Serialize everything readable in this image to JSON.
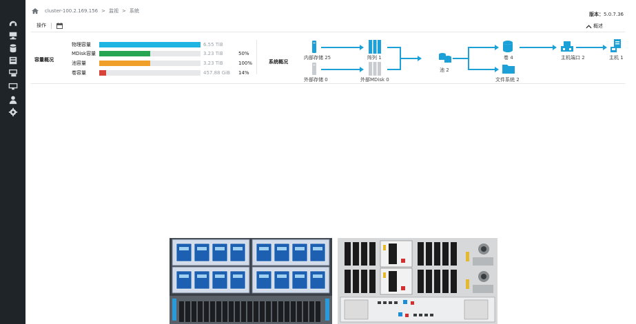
{
  "header": {
    "breadcrumb": [
      "cluster-100.2.169.156",
      "监视",
      "系统"
    ],
    "breadcrumb_sep": ">",
    "version_label": "版本：",
    "version_value": "5.0.7.36"
  },
  "toolbar": {
    "actions_label": "操作",
    "overview_label": "概述"
  },
  "sidebar": {
    "icons": [
      "dashboard-icon",
      "monitoring-icon",
      "pools-icon",
      "volumes-icon",
      "hosts-icon",
      "copy-services-icon",
      "access-icon",
      "settings-icon"
    ]
  },
  "capacity": {
    "title": "容量概况",
    "rows": [
      {
        "label": "物理容量",
        "value": "6.55 TiB",
        "percent": "",
        "fill": 1.0,
        "color": "#1fb5e3"
      },
      {
        "label": "MDisk容量",
        "value": "3.23 TiB",
        "percent": "50%",
        "fill": 0.5,
        "color": "#26a552"
      },
      {
        "label": "池容量",
        "value": "3.23 TiB",
        "percent": "100%",
        "fill": 0.5,
        "color": "#f0a02a"
      },
      {
        "label": "卷容量",
        "value": "457.88 GiB",
        "percent": "14%",
        "fill": 0.07,
        "color": "#d8433a"
      }
    ]
  },
  "system": {
    "title": "系统概况",
    "internal_storage": "内部存储 25",
    "external_storage": "外部存储 0",
    "arrays": "阵列 1",
    "external_mdisk": "外部MDisk 0",
    "pools": "池 2",
    "volumes": "卷 4",
    "filesystems": "文件系统 2",
    "host_ports": "主机端口 2",
    "hosts": "主机 1",
    "accent_color": "#1ba1d8"
  }
}
